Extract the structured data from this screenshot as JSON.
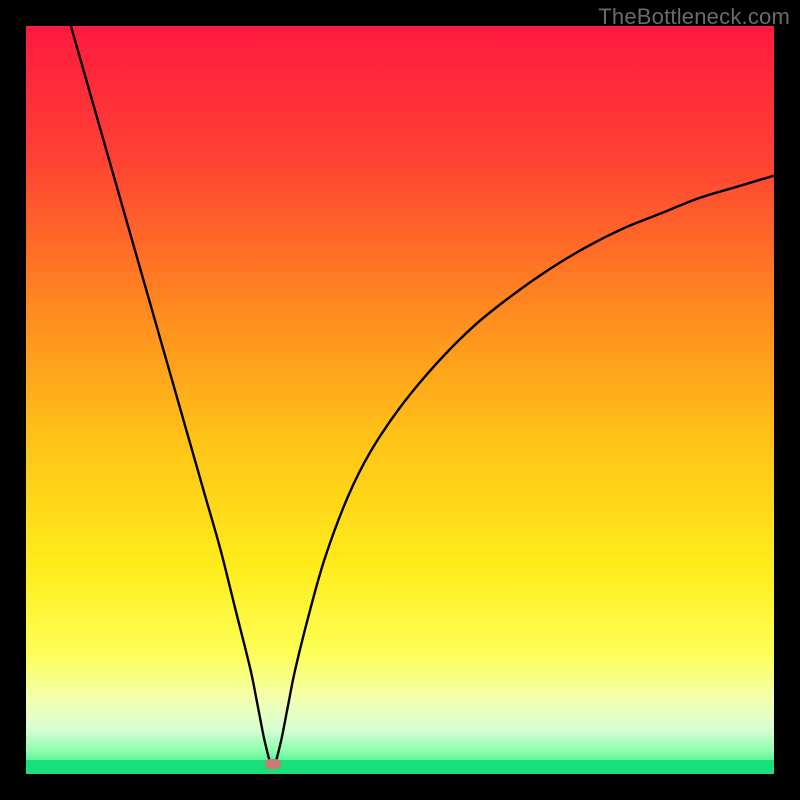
{
  "watermark": "TheBottleneck.com",
  "chart_data": {
    "type": "line",
    "title": "",
    "xlabel": "",
    "ylabel": "",
    "xlim": [
      0,
      100
    ],
    "ylim": [
      0,
      100
    ],
    "gradient_stops": [
      {
        "pct": 0,
        "color": "#ff1a40"
      },
      {
        "pct": 18,
        "color": "#ff4233"
      },
      {
        "pct": 38,
        "color": "#ff8a1f"
      },
      {
        "pct": 55,
        "color": "#ffc217"
      },
      {
        "pct": 72,
        "color": "#ffec1a"
      },
      {
        "pct": 84,
        "color": "#fdff57"
      },
      {
        "pct": 90,
        "color": "#f3ffb0"
      },
      {
        "pct": 94,
        "color": "#d7ffd3"
      },
      {
        "pct": 97,
        "color": "#8affad"
      },
      {
        "pct": 100,
        "color": "#18e07a"
      }
    ],
    "green_strip_color": "#18e07a",
    "curve_color": "#000000",
    "curve_width": 2.4,
    "marker": {
      "x": 33,
      "y": 1.3,
      "color": "#cb7a76"
    },
    "series": [
      {
        "name": "bottleneck-curve",
        "points": [
          {
            "x": 6,
            "y": 100
          },
          {
            "x": 8,
            "y": 93
          },
          {
            "x": 10,
            "y": 86
          },
          {
            "x": 12,
            "y": 79
          },
          {
            "x": 14,
            "y": 72
          },
          {
            "x": 16,
            "y": 65
          },
          {
            "x": 18,
            "y": 58
          },
          {
            "x": 20,
            "y": 51
          },
          {
            "x": 22,
            "y": 44
          },
          {
            "x": 24,
            "y": 37
          },
          {
            "x": 26,
            "y": 30
          },
          {
            "x": 28,
            "y": 22
          },
          {
            "x": 30,
            "y": 14
          },
          {
            "x": 31,
            "y": 9
          },
          {
            "x": 32,
            "y": 4
          },
          {
            "x": 33,
            "y": 1
          },
          {
            "x": 34,
            "y": 4
          },
          {
            "x": 35,
            "y": 9
          },
          {
            "x": 36,
            "y": 14
          },
          {
            "x": 38,
            "y": 22
          },
          {
            "x": 40,
            "y": 29
          },
          {
            "x": 43,
            "y": 37
          },
          {
            "x": 46,
            "y": 43
          },
          {
            "x": 50,
            "y": 49
          },
          {
            "x": 55,
            "y": 55
          },
          {
            "x": 60,
            "y": 60
          },
          {
            "x": 65,
            "y": 64
          },
          {
            "x": 70,
            "y": 67.5
          },
          {
            "x": 75,
            "y": 70.5
          },
          {
            "x": 80,
            "y": 73
          },
          {
            "x": 85,
            "y": 75
          },
          {
            "x": 90,
            "y": 77
          },
          {
            "x": 95,
            "y": 78.5
          },
          {
            "x": 100,
            "y": 80
          }
        ]
      }
    ]
  }
}
